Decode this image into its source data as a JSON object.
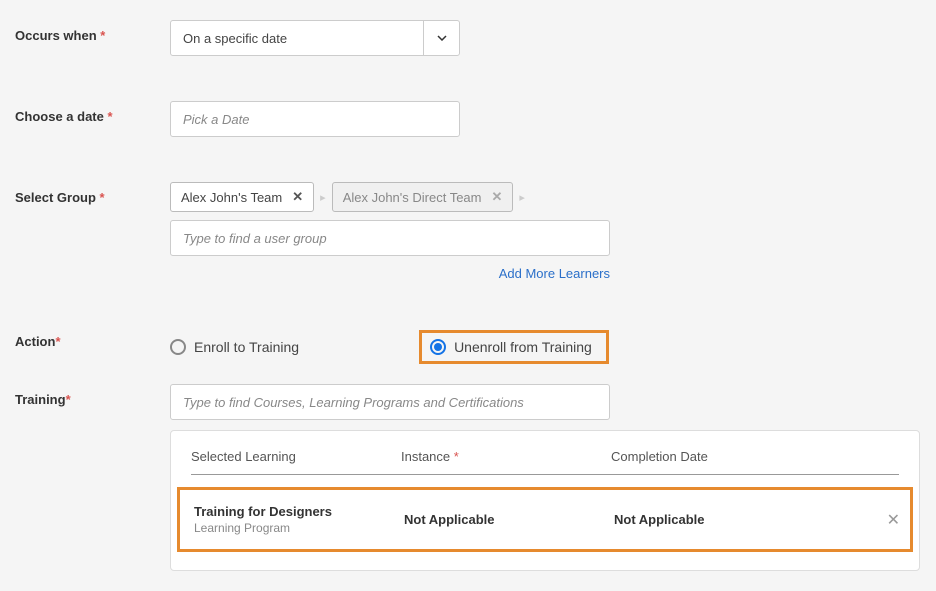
{
  "labels": {
    "occurs_when": "Occurs when",
    "choose_date": "Choose a date",
    "select_group": "Select Group",
    "action": "Action",
    "training": "Training",
    "asterisk": "*"
  },
  "occurs_when": {
    "selected": "On a specific date"
  },
  "date": {
    "placeholder": "Pick a Date"
  },
  "group": {
    "tags": [
      {
        "label": "Alex John's Team",
        "removable": true
      },
      {
        "label": "Alex John's Direct Team",
        "removable": false
      }
    ],
    "search_placeholder": "Type to find a user group",
    "add_more_label": "Add More Learners"
  },
  "action": {
    "options": {
      "enroll": "Enroll to Training",
      "unenroll": "Unenroll from Training"
    },
    "selected": "unenroll"
  },
  "training_search": {
    "placeholder": "Type to find Courses, Learning Programs and Certifications"
  },
  "training_table": {
    "headers": {
      "selected_learning": "Selected Learning",
      "instance": "Instance",
      "completion_date": "Completion Date"
    },
    "row": {
      "title": "Training for Designers",
      "subtitle": "Learning Program",
      "instance": "Not Applicable",
      "completion_date": "Not Applicable"
    }
  }
}
